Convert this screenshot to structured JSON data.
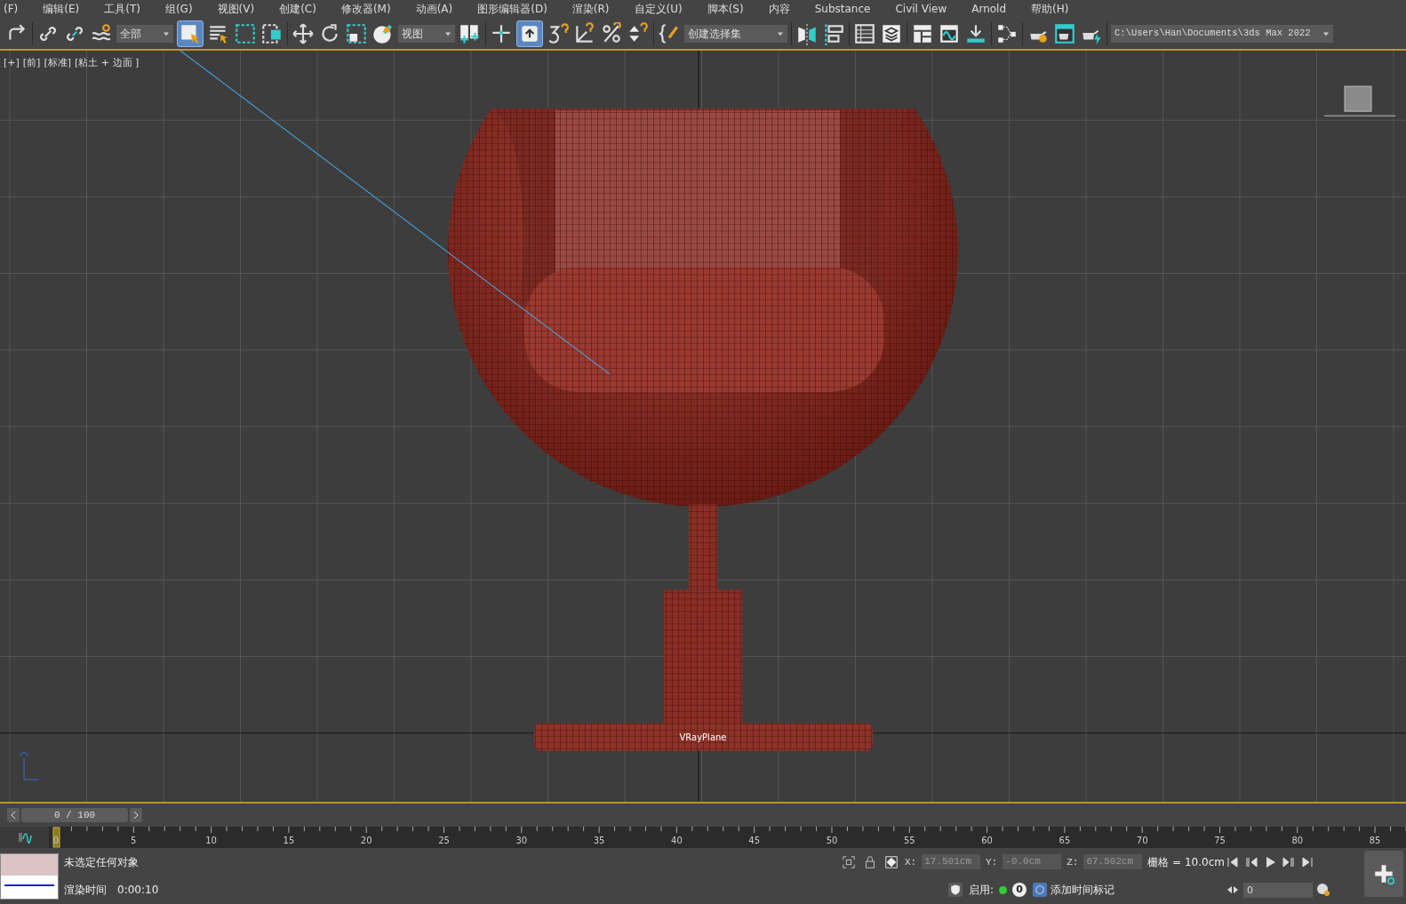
{
  "menu": [
    "(F)",
    "编辑(E)",
    "工具(T)",
    "组(G)",
    "视图(V)",
    "创建(C)",
    "修改器(M)",
    "动画(A)",
    "图形编辑器(D)",
    "渲染(R)",
    "自定义(U)",
    "脚本(S)",
    "内容",
    "Substance",
    "Civil View",
    "Arnold",
    "帮助(H)"
  ],
  "toolbar": {
    "selection_filter": "全部",
    "select_object_on": true,
    "reference_coord": "视图",
    "shortcut_override_on": true,
    "named_selection": "创建选择集",
    "project_path": "C:\\Users\\Han\\Documents\\3ds Max 2022"
  },
  "viewport": {
    "labels": [
      "[+]",
      "[前]",
      "[标准]",
      "[粘土 + 边面 ]"
    ],
    "object_label": "VRayPlane"
  },
  "time_slider": {
    "text": "0 / 100"
  },
  "timeline": {
    "tick_labels": [
      "0",
      "5",
      "10",
      "15",
      "20",
      "25",
      "30",
      "35",
      "40",
      "45",
      "50",
      "55",
      "60",
      "65",
      "70",
      "75",
      "80",
      "85"
    ]
  },
  "status": {
    "message": "未选定任何对象",
    "render_label": "渲染时间",
    "render_time": "0:00:10",
    "x_label": "X:",
    "x": "17.501cm",
    "y_label": "Y:",
    "y": "-0.0cm",
    "z_label": "Z:",
    "z": "67.502cm",
    "grid": "栅格 = 10.0cm",
    "enable_label": "启用:",
    "count": "0",
    "add_time_tag": "添加时间标记",
    "frame": "0"
  }
}
